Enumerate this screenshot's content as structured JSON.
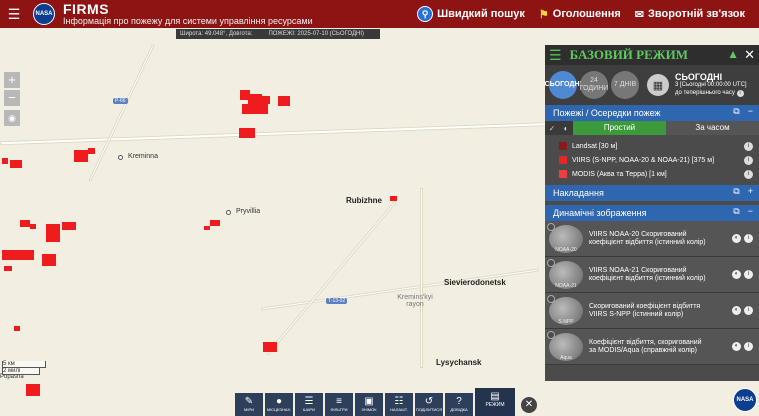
{
  "header": {
    "title": "FIRMS",
    "subtitle": "Інформація про пожежу для системи управління ресурсами",
    "logo_text": "NASA",
    "quick_search": "Швидкий пошук",
    "announcements": "Оголошення",
    "feedback": "Зворотній зв'язок"
  },
  "coordbar": {
    "coords": "Широта: 49.048°, Довгота:",
    "fires": "ПОЖЕЖІ: 2025-07-10 (СЬОГОДНІ)"
  },
  "map": {
    "places": [
      {
        "name": "Kreminna"
      },
      {
        "name": "Pryvillia"
      },
      {
        "name": "Rubizhne"
      },
      {
        "name": "Sievierodonetsk"
      },
      {
        "name": "Kremins'kyi rayon"
      },
      {
        "name": "Lysychansk"
      },
      {
        "name": "Popasna"
      }
    ],
    "road_labels": [
      "P-66",
      "T-13-02"
    ],
    "scale": {
      "km": "5 км",
      "mi": "2 милі"
    }
  },
  "panel": {
    "title": "БАЗОВИЙ РЕЖИМ",
    "date_chips": [
      "СЬОГОДНІ",
      "24 ГОДИНИ",
      "7 ДНІВ"
    ],
    "date_label": "СЬОГОДНІ",
    "date_range": "3 [Сьогодні 00:00:00 UTC]",
    "date_until": "до теперішнього часу",
    "fires_section": "Пожежі / Осередки пожеж",
    "mode_simple": "Простий",
    "mode_time": "За часом",
    "fire_layers": [
      {
        "label": "Landsat [30 м]",
        "color": "#8b1a1a"
      },
      {
        "label": "VIIRS (S-NPP, NOAA-20 & NOAA-21) [375 м]",
        "color": "#e02828"
      },
      {
        "label": "MODIS (Аква та Терра) [1 км]",
        "color": "#f03c3c"
      }
    ],
    "overlays_section": "Накладання",
    "imagery_section": "Динамічні зображення",
    "imagery": [
      {
        "thumb": "NOAA-20",
        "label": "VIIRS NOAA-20 Скоригований коефіцієнт відбиття (істинний колір)"
      },
      {
        "thumb": "NOAA-21",
        "label": "VIIRS NOAA-21 Скоригований коефіцієнт відбиття (істинний колір)"
      },
      {
        "thumb": "S-NPP",
        "label": "Скоригований коефіцієнт відбиття VIIRS S-NPP (істинний колір)"
      },
      {
        "thumb": "Aqua",
        "label": "Коефіцієнт відбиття, скоригований за MODIS/Aqua (справжній колір)"
      }
    ]
  },
  "toolbar": {
    "items": [
      "МІРИ",
      "МІСЦЕЗНАХ.",
      "ШАРИ",
      "ФІЛЬТРИ",
      "ЗНІМОК",
      "НАЛАШТ.",
      "ПОДІЛИТИСЯ",
      "ДОВІДКА"
    ],
    "mode": "РЕЖИМ"
  },
  "colors": {
    "header": "#8e1414",
    "fire": "#ee1c1c",
    "panel_accent": "#2f66b0",
    "mode_green": "#5fc95f"
  }
}
